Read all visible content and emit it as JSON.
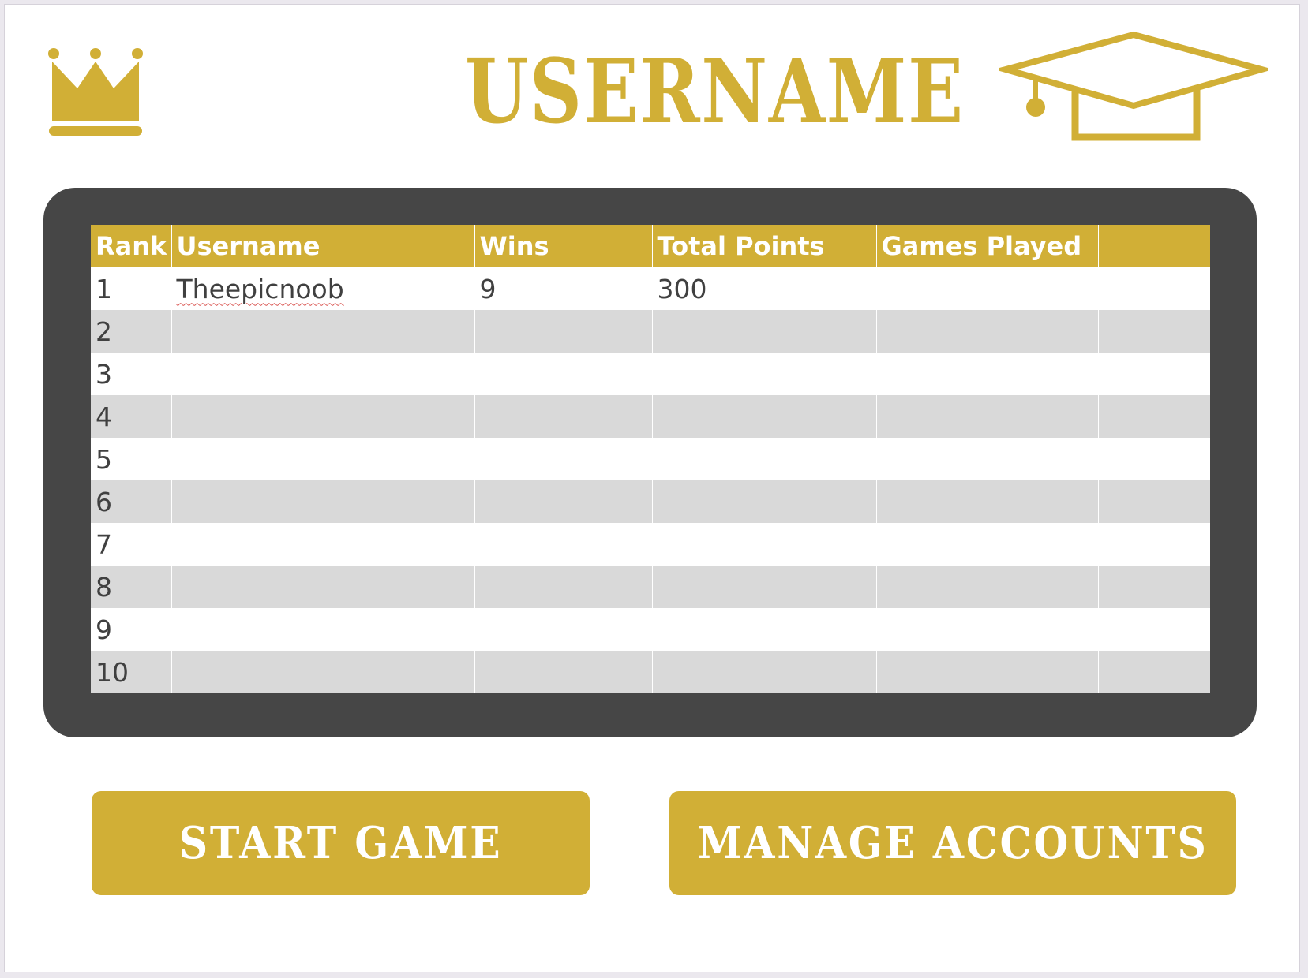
{
  "header": {
    "title": "USERNAME",
    "left_icon": "crown-icon",
    "right_icon": "graduation-cap-icon"
  },
  "leaderboard": {
    "columns": [
      "Rank",
      "Username",
      "Wins",
      "Total Points",
      "Games Played",
      ""
    ],
    "rows": [
      [
        "1",
        "Theepicnoob",
        "9",
        "300",
        "",
        ""
      ],
      [
        "2",
        "",
        "",
        "",
        "",
        ""
      ],
      [
        "3",
        "",
        "",
        "",
        "",
        ""
      ],
      [
        "4",
        "",
        "",
        "",
        "",
        ""
      ],
      [
        "5",
        "",
        "",
        "",
        "",
        ""
      ],
      [
        "6",
        "",
        "",
        "",
        "",
        ""
      ],
      [
        "7",
        "",
        "",
        "",
        "",
        ""
      ],
      [
        "8",
        "",
        "",
        "",
        "",
        ""
      ],
      [
        "9",
        "",
        "",
        "",
        "",
        ""
      ],
      [
        "10",
        "",
        "",
        "",
        "",
        ""
      ]
    ]
  },
  "buttons": {
    "start_game": "START GAME",
    "manage_accounts": "MANAGE ACCOUNTS"
  },
  "colors": {
    "accent_gold": "#d1af36",
    "frame_dark": "#464646",
    "row_stripe": "#d9d9d9",
    "cell_text": "#404040"
  }
}
